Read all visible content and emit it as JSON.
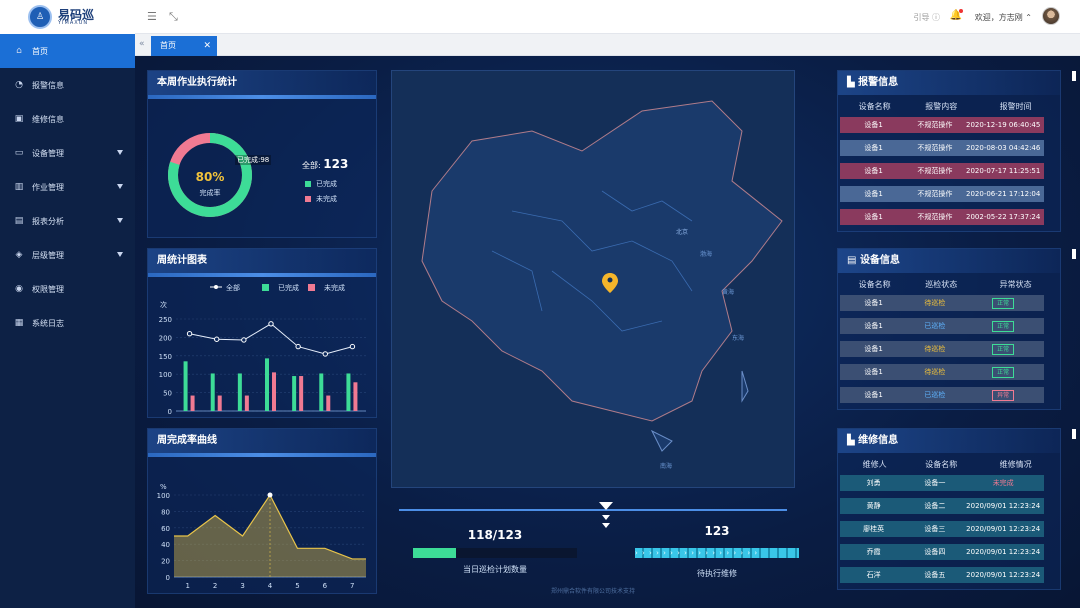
{
  "app": {
    "name": "易码巡",
    "sub": "YIMAXUN"
  },
  "topbar": {
    "guide": "引导 ⓘ",
    "welcome": "欢迎，方志刚"
  },
  "sidebar": {
    "items": [
      {
        "label": "首页",
        "icon": "home-icon"
      },
      {
        "label": "报警信息",
        "icon": "bell-icon"
      },
      {
        "label": "维修信息",
        "icon": "wrench-icon"
      },
      {
        "label": "设备管理",
        "icon": "device-icon"
      },
      {
        "label": "作业管理",
        "icon": "task-icon"
      },
      {
        "label": "报表分析",
        "icon": "report-icon"
      },
      {
        "label": "层级管理",
        "icon": "layers-icon"
      },
      {
        "label": "权限管理",
        "icon": "lock-icon"
      },
      {
        "label": "系统日志",
        "icon": "log-icon"
      }
    ]
  },
  "tabs": {
    "home": "首页"
  },
  "weekly_exec": {
    "title": "本周作业执行统计",
    "percent": "80%",
    "rate_label": "完成率",
    "done_label": "已完成:98",
    "total_label": "全部:",
    "total": "123",
    "legend_done": "已完成",
    "legend_undone": "未完成",
    "color_done": "#3ddc97",
    "color_undone": "#f07a92",
    "done_fraction": 0.8
  },
  "weekly_chart": {
    "title": "周统计图表",
    "ylabel": "次",
    "legend": [
      "全部",
      "已完成",
      "未完成"
    ]
  },
  "curve": {
    "title": "周完成率曲线",
    "ylabel": "%"
  },
  "alarm": {
    "title": "报警信息",
    "headers": [
      "设备名称",
      "报警内容",
      "报警时间"
    ],
    "rows": [
      [
        "设备1",
        "不规范操作",
        "2020-12-19 06:40:45"
      ],
      [
        "设备1",
        "不规范操作",
        "2020-08-03 04:42:46"
      ],
      [
        "设备1",
        "不规范操作",
        "2020-07-17 11:25:51"
      ],
      [
        "设备1",
        "不规范操作",
        "2020-06-21 17:12:04"
      ],
      [
        "设备1",
        "不规范操作",
        "2002-05-22 17:37:24"
      ]
    ]
  },
  "device": {
    "title": "设备信息",
    "headers": [
      "设备名称",
      "巡检状态",
      "异常状态"
    ],
    "rows": [
      [
        "设备1",
        "待巡检",
        "正常"
      ],
      [
        "设备1",
        "已巡检",
        "正常"
      ],
      [
        "设备1",
        "待巡检",
        "正常"
      ],
      [
        "设备1",
        "待巡检",
        "正常"
      ],
      [
        "设备1",
        "已巡检",
        "异常"
      ]
    ]
  },
  "repair": {
    "title": "维修信息",
    "headers": [
      "维修人",
      "设备名称",
      "维修情况"
    ],
    "rows": [
      [
        "刘勇",
        "设备一",
        "未完成"
      ],
      [
        "黄静",
        "设备二",
        "2020/09/01  12:23:24"
      ],
      [
        "廖桂英",
        "设备三",
        "2020/09/01  12:23:24"
      ],
      [
        "乔霞",
        "设备四",
        "2020/09/01  12:23:24"
      ],
      [
        "石洋",
        "设备五",
        "2020/09/01  12:23:24"
      ]
    ]
  },
  "bottom": {
    "plan_value": "118/123",
    "plan_label": "当日巡检计划数量",
    "plan_fraction": 0.26,
    "repair_value": "123",
    "repair_label": "待执行维修",
    "footer": "郑州鼎合软件有限公司技术支持"
  },
  "map": {
    "labels": [
      "北京",
      "渤海",
      "黄海",
      "东海",
      "南海"
    ]
  },
  "chart_data": [
    {
      "type": "bar",
      "categories": [
        "1",
        "2",
        "3",
        "4",
        "5",
        "6",
        "7"
      ],
      "ylabel": "次",
      "ylim": [
        0,
        250
      ],
      "yticks": [
        0,
        50,
        100,
        150,
        200,
        250
      ],
      "series": [
        {
          "name": "全部",
          "type": "line",
          "values": [
            210,
            195,
            193,
            237,
            175,
            155,
            175
          ],
          "color": "#ffffff"
        },
        {
          "name": "已完成",
          "values": [
            135,
            102,
            102,
            143,
            95,
            102,
            102
          ],
          "color": "#3ddc97"
        },
        {
          "name": "未完成",
          "values": [
            42,
            42,
            42,
            105,
            95,
            42,
            78
          ],
          "color": "#f07a92"
        }
      ],
      "legend": "top-center"
    },
    {
      "type": "area",
      "categories": [
        "1",
        "2",
        "3",
        "4",
        "5",
        "6",
        "7"
      ],
      "ylabel": "%",
      "ylim": [
        0,
        100
      ],
      "yticks": [
        0,
        20,
        40,
        60,
        80,
        100
      ],
      "series": [
        {
          "values": [
            50,
            75,
            50,
            100,
            35,
            35,
            22
          ],
          "color": "#e8c44a"
        }
      ]
    }
  ]
}
